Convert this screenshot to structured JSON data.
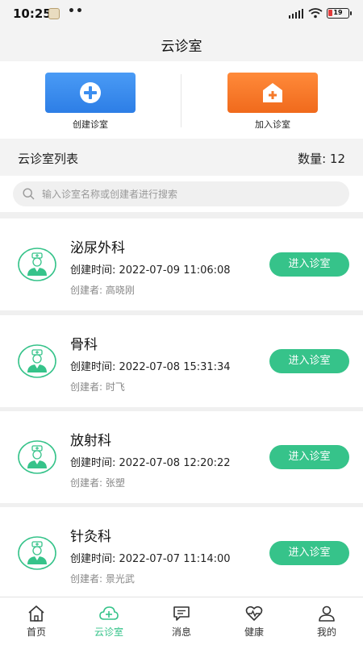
{
  "status_bar": {
    "time": "10:25",
    "dots": "••",
    "battery": "19"
  },
  "header": {
    "title": "云诊室"
  },
  "actions": [
    {
      "label": "创建诊室",
      "icon": "plus-circle-icon",
      "color": "#3b8ef0"
    },
    {
      "label": "加入诊室",
      "icon": "house-plus-icon",
      "color": "#f57a2a"
    }
  ],
  "list_header": {
    "title": "云诊室列表",
    "count_label": "数量: 12"
  },
  "search": {
    "placeholder": "输入诊室名称或创建者进行搜索",
    "value": ""
  },
  "clinics": [
    {
      "name": "泌尿外科",
      "created": "创建时间: 2022-07-09 11:06:08",
      "creator": "创建者: 高晓刚",
      "button": "进入诊室"
    },
    {
      "name": "骨科",
      "created": "创建时间: 2022-07-08 15:31:34",
      "creator": "创建者: 时飞",
      "button": "进入诊室"
    },
    {
      "name": "放射科",
      "created": "创建时间: 2022-07-08 12:20:22",
      "creator": "创建者: 张塑",
      "button": "进入诊室"
    },
    {
      "name": "针灸科",
      "created": "创建时间: 2022-07-07 11:14:00",
      "creator": "创建者: 景光武",
      "button": "进入诊室"
    }
  ],
  "tabs": [
    {
      "label": "首页",
      "icon": "home-icon",
      "active": false
    },
    {
      "label": "云诊室",
      "icon": "cloud-plus-icon",
      "active": true
    },
    {
      "label": "消息",
      "icon": "message-icon",
      "active": false
    },
    {
      "label": "健康",
      "icon": "heart-pulse-icon",
      "active": false
    },
    {
      "label": "我的",
      "icon": "user-icon",
      "active": false
    }
  ],
  "colors": {
    "accent": "#36c38a",
    "create_button": "#3b8ef0",
    "join_button": "#f57a2a"
  }
}
